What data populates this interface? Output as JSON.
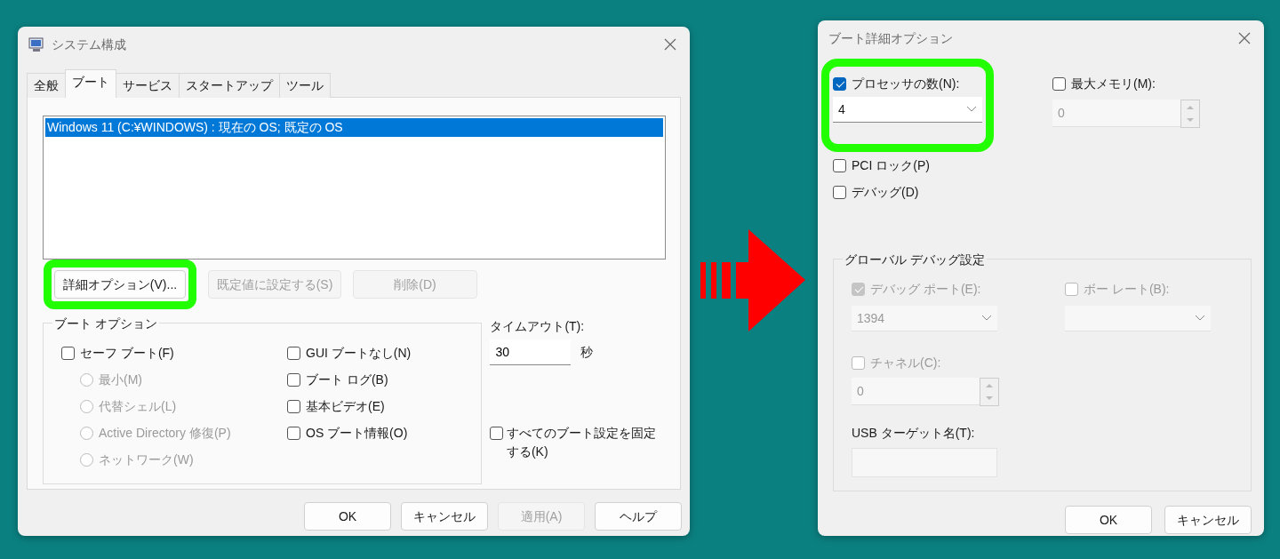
{
  "main_window": {
    "title": "システム構成",
    "tabs": [
      {
        "label": "全般",
        "selected": false
      },
      {
        "label": "ブート",
        "selected": true
      },
      {
        "label": "サービス",
        "selected": false
      },
      {
        "label": "スタートアップ",
        "selected": false
      },
      {
        "label": "ツール",
        "selected": false
      }
    ],
    "boot_list": [
      {
        "label": "Windows 11 (C:¥WINDOWS) : 現在の OS; 既定の OS",
        "selected": true
      }
    ],
    "list_buttons": [
      {
        "label": "詳細オプション(V)...",
        "disabled": false,
        "highlighted": true
      },
      {
        "label": "既定値に設定する(S)",
        "disabled": true,
        "highlighted": false
      },
      {
        "label": "削除(D)",
        "disabled": true,
        "highlighted": false
      }
    ],
    "boot_options": {
      "title": "ブート オプション",
      "left": [
        {
          "kind": "checkbox",
          "label": "セーフ ブート(F)",
          "checked": false,
          "disabled": false
        },
        {
          "kind": "radio",
          "label": "最小(M)",
          "selected": false,
          "disabled": true
        },
        {
          "kind": "radio",
          "label": "代替シェル(L)",
          "selected": false,
          "disabled": true
        },
        {
          "kind": "radio",
          "label": "Active Directory 修復(P)",
          "selected": false,
          "disabled": true
        },
        {
          "kind": "radio",
          "label": "ネットワーク(W)",
          "selected": false,
          "disabled": true
        }
      ],
      "right": [
        {
          "kind": "checkbox",
          "label": "GUI ブートなし(N)",
          "checked": false,
          "disabled": false
        },
        {
          "kind": "checkbox",
          "label": "ブート ログ(B)",
          "checked": false,
          "disabled": false
        },
        {
          "kind": "checkbox",
          "label": "基本ビデオ(E)",
          "checked": false,
          "disabled": false
        },
        {
          "kind": "checkbox",
          "label": "OS ブート情報(O)",
          "checked": false,
          "disabled": false
        }
      ]
    },
    "timeout": {
      "label": "タイムアウト(T):",
      "value": "30",
      "unit": "秒"
    },
    "make_permanent": {
      "label": "すべてのブート設定を固定する(K)",
      "checked": false
    },
    "buttons": [
      {
        "label": "OK",
        "disabled": false
      },
      {
        "label": "キャンセル",
        "disabled": false
      },
      {
        "label": "適用(A)",
        "disabled": true
      },
      {
        "label": "ヘルプ",
        "disabled": false
      }
    ]
  },
  "advanced_window": {
    "title": "ブート詳細オプション",
    "processors": {
      "label": "プロセッサの数(N):",
      "checked": true,
      "value": "4",
      "highlighted": true
    },
    "max_memory": {
      "label": "最大メモリ(M):",
      "checked": false,
      "value": "0"
    },
    "pci_lock": {
      "label": "PCI ロック(P)",
      "checked": false
    },
    "debug": {
      "label": "デバッグ(D)",
      "checked": false
    },
    "global_debug": {
      "title": "グローバル デバッグ設定",
      "debug_port": {
        "label": "デバッグ ポート(E):",
        "checked": true,
        "disabled": true,
        "value": "1394"
      },
      "baud_rate": {
        "label": "ボー レート(B):",
        "checked": false,
        "disabled": true
      },
      "channel": {
        "label": "チャネル(C):",
        "checked": false,
        "disabled": true,
        "value": "0"
      },
      "usb_target": {
        "label": "USB ターゲット名(T):"
      }
    },
    "buttons": [
      {
        "label": "OK"
      },
      {
        "label": "キャンセル"
      }
    ]
  }
}
